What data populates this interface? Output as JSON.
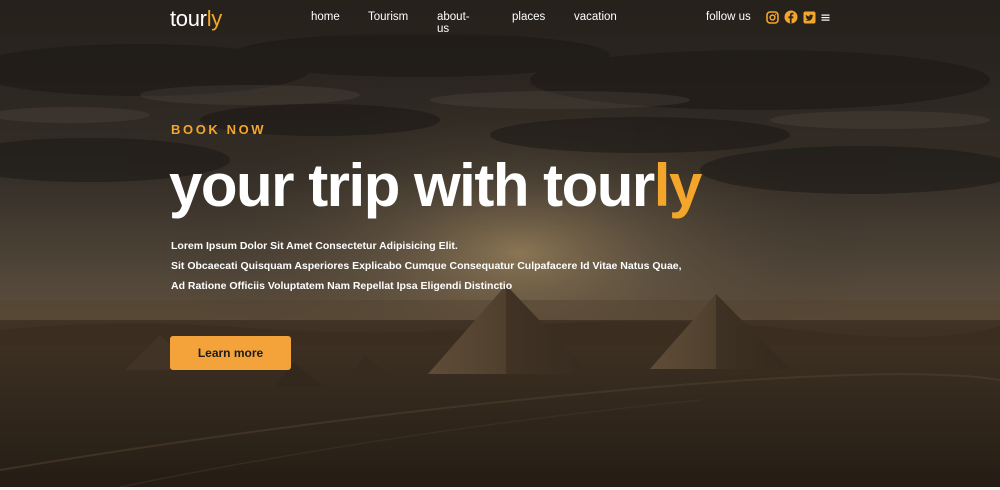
{
  "brand": {
    "name_main": "tour",
    "name_accent": "ly"
  },
  "nav": {
    "links": [
      "home",
      "Tourism",
      "about-us",
      "places",
      "vacation"
    ],
    "follow_label": "follow us",
    "socials": [
      "instagram-icon",
      "facebook-icon",
      "twitter-icon",
      "menu-icon"
    ]
  },
  "hero": {
    "eyebrow": "BOOK NOW",
    "headline_main": "your trip with tour",
    "headline_accent": "ly",
    "description": [
      "Lorem Ipsum Dolor Sit Amet Consectetur Adipisicing Elit.",
      "Sit Obcaecati Quisquam Asperiores Explicabo Cumque Consequatur Culpafacere Id Vitae Natus Quae,",
      "Ad Ratione Officiis Voluptatem Nam Repellat Ipsa Eligendi Distinctio"
    ],
    "cta_label": "Learn more"
  },
  "colors": {
    "accent": "#f4a62a",
    "button": "#f4a33a",
    "text": "#ffffff"
  }
}
